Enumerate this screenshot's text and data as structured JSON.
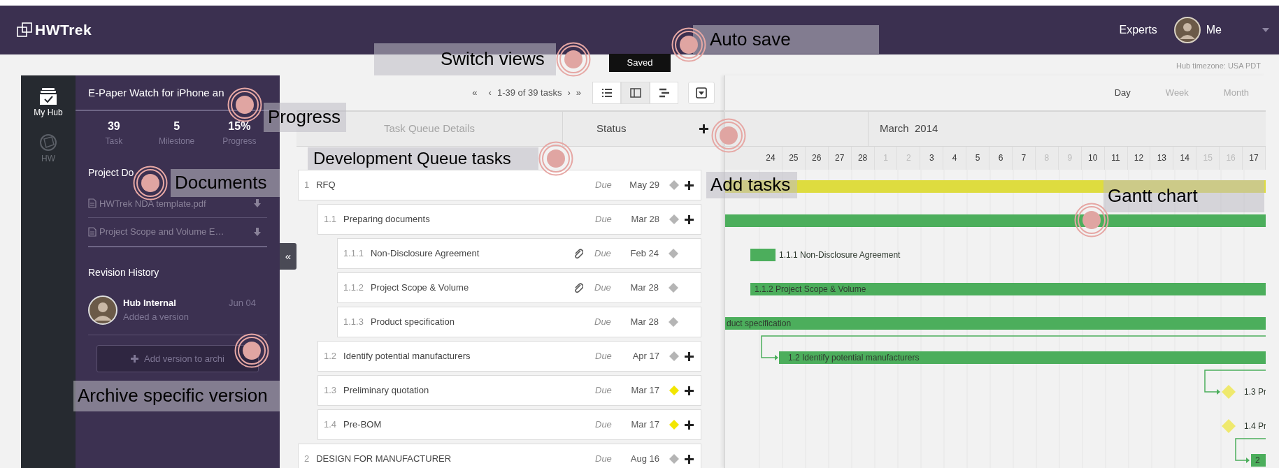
{
  "navbar": {
    "logo": "HWTrek",
    "links": [
      {
        "label": "Experts"
      }
    ],
    "user": {
      "name": "Me"
    },
    "autosave_status": "Saved"
  },
  "timezone": "Hub timezone: USA PDT",
  "rail": [
    {
      "label": "My Hub",
      "selected": true
    },
    {
      "label": "HW",
      "selected": false
    }
  ],
  "project": {
    "title": "E-Paper Watch for iPhone an",
    "stats": [
      {
        "value": "39",
        "label": "Task"
      },
      {
        "value": "5",
        "label": "Milestone"
      },
      {
        "value": "15%",
        "label": "Progress"
      }
    ],
    "docs_heading": "Project Do",
    "docs": [
      {
        "name": "HWTrek NDA template.pdf"
      },
      {
        "name": "Project Scope and Volume E…"
      }
    ],
    "revision_heading": "Revision History",
    "revisions": [
      {
        "author": "Hub Internal",
        "date": "Jun 04",
        "action": "Added a version"
      }
    ],
    "add_version": "Add version to archi"
  },
  "collapse": "«",
  "pager": {
    "first": "«",
    "prev": "‹",
    "range": "1-39 of 39 tasks",
    "next": "›",
    "last": "»"
  },
  "views": [
    {
      "kind": "list",
      "selected": false
    },
    {
      "kind": "split",
      "selected": true
    },
    {
      "kind": "gantt",
      "selected": false
    }
  ],
  "table": {
    "columns": [
      "Task Queue Details",
      "Status"
    ]
  },
  "tasks": [
    {
      "number": "1",
      "title": "RFQ",
      "attachment": false,
      "due_label": "Due",
      "due": "May 29",
      "color": "#b5b5b5",
      "can_add": true,
      "children": [
        {
          "number": "1.1",
          "title": "Preparing documents",
          "attachment": false,
          "due_label": "Due",
          "due": "Mar 28",
          "color": "#b5b5b5",
          "can_add": true,
          "children": [
            {
              "number": "1.1.1",
              "title": "Non-Disclosure Agreement",
              "attachment": true,
              "due_label": "Due",
              "due": "Feb 24",
              "color": "#b5b5b5",
              "can_add": false
            },
            {
              "number": "1.1.2",
              "title": "Project Scope & Volume",
              "attachment": true,
              "due_label": "Due",
              "due": "Mar 28",
              "color": "#b5b5b5",
              "can_add": false
            },
            {
              "number": "1.1.3",
              "title": "Product specification",
              "attachment": false,
              "due_label": "Due",
              "due": "Mar 28",
              "color": "#b5b5b5",
              "can_add": false
            }
          ]
        },
        {
          "number": "1.2",
          "title": "Identify potential manufacturers",
          "attachment": false,
          "due_label": "Due",
          "due": "Apr 17",
          "color": "#b5b5b5",
          "can_add": true
        },
        {
          "number": "1.3",
          "title": "Preliminary quotation",
          "attachment": false,
          "due_label": "Due",
          "due": "Mar 17",
          "color": "#f2e600",
          "can_add": true
        },
        {
          "number": "1.4",
          "title": "Pre-BOM",
          "attachment": false,
          "due_label": "Due",
          "due": "Mar 17",
          "color": "#f2e600",
          "can_add": true
        }
      ]
    },
    {
      "number": "2",
      "title": "DESIGN FOR MANUFACTURER",
      "attachment": false,
      "due_label": "Due",
      "due": "Aug 16",
      "color": "#b5b5b5",
      "can_add": true
    }
  ],
  "scale": [
    {
      "label": "Day",
      "selected": true
    },
    {
      "label": "Week",
      "selected": false
    },
    {
      "label": "Month",
      "selected": false
    }
  ],
  "gantt": {
    "month": "March  2014",
    "days": [
      {
        "label": "24",
        "weekend": false
      },
      {
        "label": "25",
        "weekend": false
      },
      {
        "label": "26",
        "weekend": false
      },
      {
        "label": "27",
        "weekend": false
      },
      {
        "label": "28",
        "weekend": false
      },
      {
        "label": "1",
        "weekend": true
      },
      {
        "label": "2",
        "weekend": true
      },
      {
        "label": "3",
        "weekend": false
      },
      {
        "label": "4",
        "weekend": false
      },
      {
        "label": "5",
        "weekend": false
      },
      {
        "label": "6",
        "weekend": false
      },
      {
        "label": "7",
        "weekend": false
      },
      {
        "label": "8",
        "weekend": true
      },
      {
        "label": "9",
        "weekend": true
      },
      {
        "label": "10",
        "weekend": false
      },
      {
        "label": "11",
        "weekend": false
      },
      {
        "label": "12",
        "weekend": false
      },
      {
        "label": "13",
        "weekend": false
      },
      {
        "label": "14",
        "weekend": false
      },
      {
        "label": "15",
        "weekend": true
      },
      {
        "label": "16",
        "weekend": true
      },
      {
        "label": "17",
        "weekend": false
      }
    ],
    "bars": [
      {
        "kind": "bar",
        "color": "#dedc3f"
      },
      {
        "kind": "bar",
        "color": "#4cae5c"
      },
      {
        "kind": "bar",
        "color": "#4cae5c",
        "label": "1.1.1 Non-Disclosure Agreement"
      },
      {
        "kind": "bar",
        "color": "#4cae5c",
        "label": "1.1.2 Project Scope & Volume"
      },
      {
        "kind": "bar",
        "color": "#4cae5c",
        "label": "duct specification"
      },
      {
        "kind": "bar",
        "color": "#4cae5c",
        "label": "1.2 Identify potential manufacturers"
      },
      {
        "kind": "milestone",
        "color": "#efe96e",
        "label": "1.3 Pr"
      },
      {
        "kind": "milestone",
        "color": "#efe96e",
        "label": "1.4 Pr"
      },
      {
        "kind": "bar",
        "color": "#4cae5c",
        "label": "2"
      }
    ]
  },
  "annotations": [
    {
      "text": "Auto save"
    },
    {
      "text": "Switch views"
    },
    {
      "text": "Progress"
    },
    {
      "text": "Documents"
    },
    {
      "text": "Development Queue tasks"
    },
    {
      "text": "Add tasks"
    },
    {
      "text": "Gantt chart"
    },
    {
      "text": "Archive specific version"
    }
  ]
}
